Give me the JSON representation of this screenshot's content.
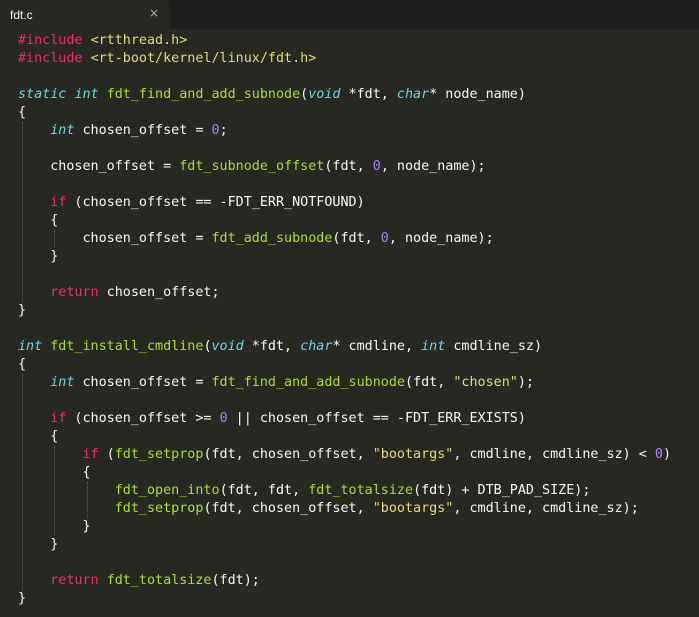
{
  "tab": {
    "title": "fdt.c",
    "close_glyph": "×"
  },
  "theme": {
    "background": "#272822",
    "keyword": "#f92672",
    "type": "#66d9ef",
    "function": "#a6e22e",
    "number": "#ae81ff",
    "string": "#e6db74",
    "plain": "#f8f8f2"
  },
  "code_lines": [
    [
      [
        "kw",
        "#include"
      ],
      [
        "p",
        " "
      ],
      [
        "str",
        "<rtthread.h>"
      ]
    ],
    [
      [
        "kw",
        "#include"
      ],
      [
        "p",
        " "
      ],
      [
        "str",
        "<rt-boot/kernel/linux/fdt.h>"
      ]
    ],
    [],
    [
      [
        "ty",
        "static"
      ],
      [
        "p",
        " "
      ],
      [
        "ty",
        "int"
      ],
      [
        "p",
        " "
      ],
      [
        "fn",
        "fdt_find_and_add_subnode"
      ],
      [
        "p",
        "("
      ],
      [
        "ty",
        "void"
      ],
      [
        "p",
        " *fdt, "
      ],
      [
        "ty",
        "char"
      ],
      [
        "p",
        "* node_name)"
      ]
    ],
    [
      [
        "p",
        "{"
      ]
    ],
    [
      [
        "p",
        "    "
      ],
      [
        "ty",
        "int"
      ],
      [
        "p",
        " chosen_offset = "
      ],
      [
        "num",
        "0"
      ],
      [
        "p",
        ";"
      ]
    ],
    [],
    [
      [
        "p",
        "    chosen_offset = "
      ],
      [
        "fn",
        "fdt_subnode_offset"
      ],
      [
        "p",
        "(fdt, "
      ],
      [
        "num",
        "0"
      ],
      [
        "p",
        ", node_name);"
      ]
    ],
    [],
    [
      [
        "p",
        "    "
      ],
      [
        "kw",
        "if"
      ],
      [
        "p",
        " (chosen_offset == -FDT_ERR_NOTFOUND)"
      ]
    ],
    [
      [
        "p",
        "    {"
      ]
    ],
    [
      [
        "p",
        "        chosen_offset = "
      ],
      [
        "fn",
        "fdt_add_subnode"
      ],
      [
        "p",
        "(fdt, "
      ],
      [
        "num",
        "0"
      ],
      [
        "p",
        ", node_name);"
      ]
    ],
    [
      [
        "p",
        "    }"
      ]
    ],
    [],
    [
      [
        "p",
        "    "
      ],
      [
        "kw",
        "return"
      ],
      [
        "p",
        " chosen_offset;"
      ]
    ],
    [
      [
        "p",
        "}"
      ]
    ],
    [],
    [
      [
        "ty",
        "int"
      ],
      [
        "p",
        " "
      ],
      [
        "fn",
        "fdt_install_cmdline"
      ],
      [
        "p",
        "("
      ],
      [
        "ty",
        "void"
      ],
      [
        "p",
        " *fdt, "
      ],
      [
        "ty",
        "char"
      ],
      [
        "p",
        "* cmdline, "
      ],
      [
        "ty",
        "int"
      ],
      [
        "p",
        " cmdline_sz)"
      ]
    ],
    [
      [
        "p",
        "{"
      ]
    ],
    [
      [
        "p",
        "    "
      ],
      [
        "ty",
        "int"
      ],
      [
        "p",
        " chosen_offset = "
      ],
      [
        "fn",
        "fdt_find_and_add_subnode"
      ],
      [
        "p",
        "(fdt, "
      ],
      [
        "str",
        "\"chosen\""
      ],
      [
        "p",
        ");"
      ]
    ],
    [],
    [
      [
        "p",
        "    "
      ],
      [
        "kw",
        "if"
      ],
      [
        "p",
        " (chosen_offset >= "
      ],
      [
        "num",
        "0"
      ],
      [
        "p",
        " || chosen_offset == -FDT_ERR_EXISTS)"
      ]
    ],
    [
      [
        "p",
        "    {"
      ]
    ],
    [
      [
        "p",
        "        "
      ],
      [
        "kw",
        "if"
      ],
      [
        "p",
        " ("
      ],
      [
        "fn",
        "fdt_setprop"
      ],
      [
        "p",
        "(fdt, chosen_offset, "
      ],
      [
        "str",
        "\"bootargs\""
      ],
      [
        "p",
        ", cmdline, cmdline_sz) < "
      ],
      [
        "num",
        "0"
      ],
      [
        "p",
        ")"
      ]
    ],
    [
      [
        "p",
        "        {"
      ]
    ],
    [
      [
        "p",
        "            "
      ],
      [
        "fn",
        "fdt_open_into"
      ],
      [
        "p",
        "(fdt, fdt, "
      ],
      [
        "fn",
        "fdt_totalsize"
      ],
      [
        "p",
        "(fdt) + DTB_PAD_SIZE);"
      ]
    ],
    [
      [
        "p",
        "            "
      ],
      [
        "fn",
        "fdt_setprop"
      ],
      [
        "p",
        "(fdt, chosen_offset, "
      ],
      [
        "str",
        "\"bootargs\""
      ],
      [
        "p",
        ", cmdline, cmdline_sz);"
      ]
    ],
    [
      [
        "p",
        "        }"
      ]
    ],
    [
      [
        "p",
        "    }"
      ]
    ],
    [],
    [
      [
        "p",
        "    "
      ],
      [
        "kw",
        "return"
      ],
      [
        "p",
        " "
      ],
      [
        "fn",
        "fdt_totalsize"
      ],
      [
        "p",
        "(fdt);"
      ]
    ],
    [
      [
        "p",
        "}"
      ]
    ]
  ]
}
